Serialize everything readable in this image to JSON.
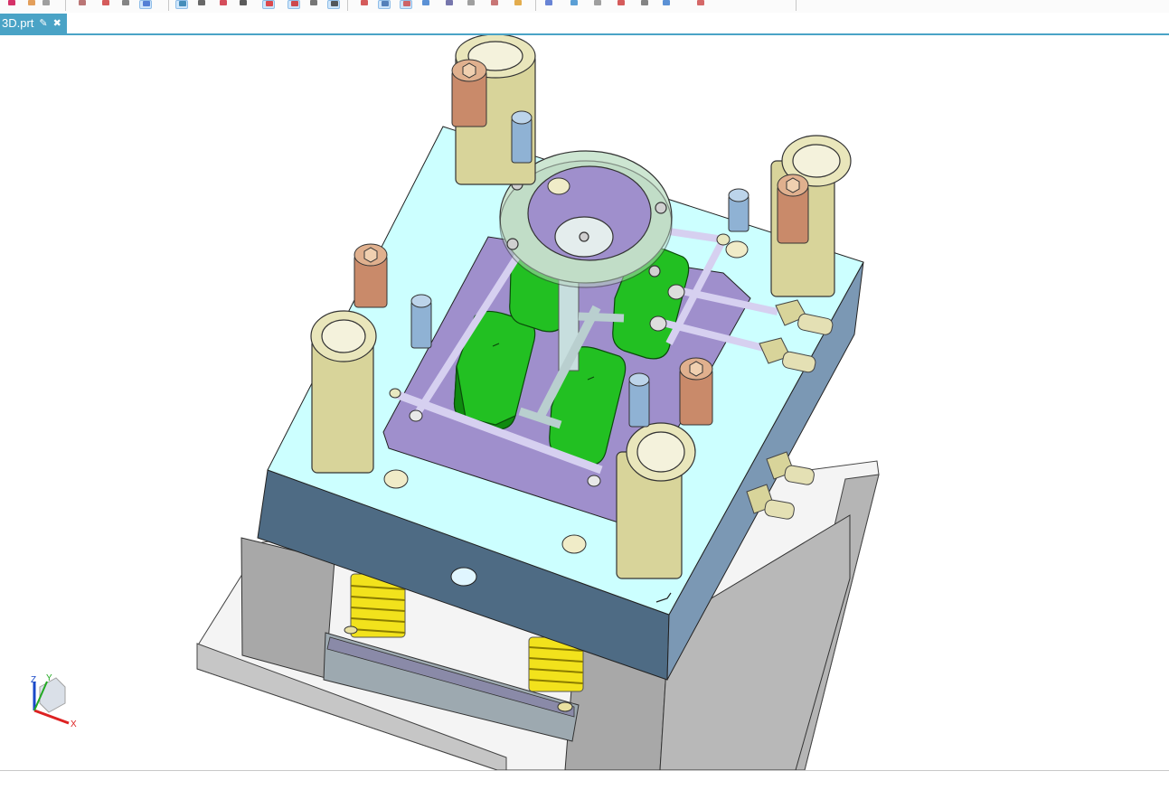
{
  "toolbar": {
    "buttons": [
      {
        "icon": "undo-icon"
      },
      {
        "icon": "open-icon"
      },
      {
        "icon": "snap-point-icon"
      },
      {
        "icon": "move-icon"
      },
      {
        "icon": "select-window-icon"
      },
      {
        "icon": "box-icon"
      },
      {
        "icon": "shaded-view-icon",
        "selected": true
      },
      {
        "icon": "wireframe-icon",
        "selected": true
      },
      {
        "icon": "line-icon"
      },
      {
        "icon": "arrow-icon"
      },
      {
        "icon": "arc-icon"
      },
      {
        "icon": "constraint-icon",
        "selected": true
      },
      {
        "icon": "dimension-icon",
        "selected": true
      },
      {
        "icon": "axis-icon"
      },
      {
        "icon": "rotate-icon",
        "selected": true
      },
      {
        "icon": "refresh-icon"
      },
      {
        "icon": "sketch-icon",
        "selected": true
      },
      {
        "icon": "pencil-icon",
        "selected": true
      },
      {
        "icon": "view-orient-icon"
      },
      {
        "icon": "layer-icon"
      },
      {
        "icon": "print-icon"
      },
      {
        "icon": "measure-icon"
      },
      {
        "icon": "folder-icon"
      },
      {
        "icon": "redo-icon"
      },
      {
        "icon": "edit-icon"
      },
      {
        "icon": "save-icon"
      },
      {
        "icon": "table-icon"
      },
      {
        "icon": "render-icon"
      },
      {
        "icon": "cube-icon"
      },
      {
        "icon": "tools-icon"
      }
    ]
  },
  "tab": {
    "title": "3D.prt",
    "modified_icon": "document-edit-icon",
    "close_icon": "close-icon"
  },
  "triad": {
    "z_label": "Z",
    "y_label": "Y",
    "x_label": "X"
  },
  "colors": {
    "accent": "#4aa3c6",
    "plate_cyan": "#ccffff",
    "plate_side": "#4e6b84",
    "cavity_purple": "#9f8fcc",
    "cavity_green": "#1fbf1f",
    "guide_bush": "#d8d49a",
    "spring_yellow": "#f0e020",
    "support_gray": "#a9a9a9"
  }
}
